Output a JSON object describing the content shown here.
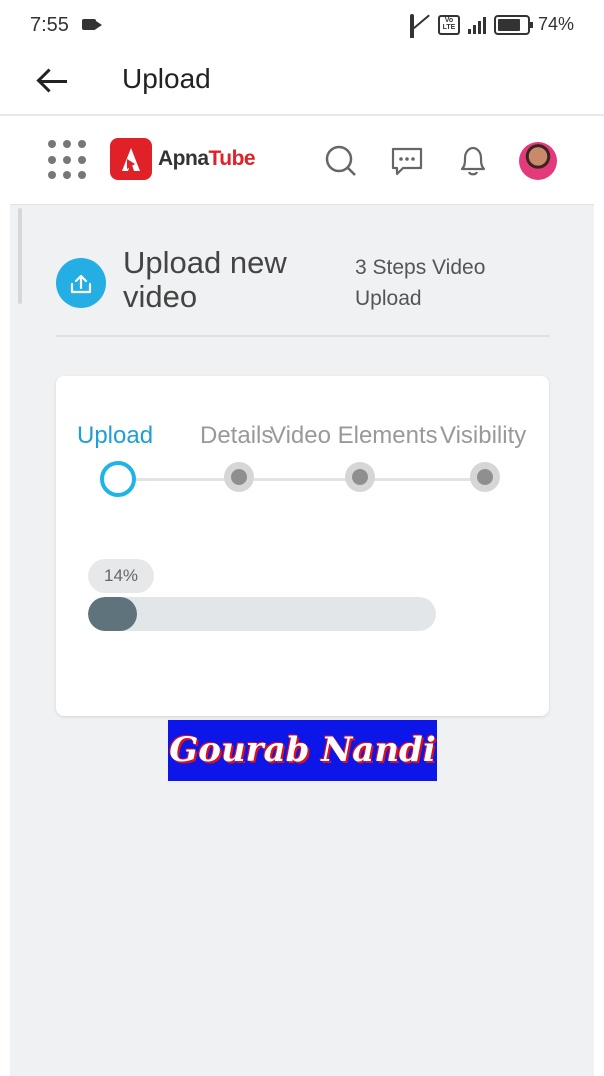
{
  "status_bar": {
    "time": "7:55",
    "battery": "74%",
    "icons": [
      "video-camera-icon",
      "bell-off-icon",
      "volte-icon",
      "signal-4g-icon",
      "battery-icon"
    ]
  },
  "app_bar": {
    "title": "Upload",
    "back_icon": "arrow-left-icon"
  },
  "header": {
    "brand_first": "Apna",
    "brand_second": "Tube",
    "brand_color": "#e02127",
    "icons": [
      "apps-grid-icon",
      "search-icon",
      "message-icon",
      "notification-bell-icon",
      "avatar"
    ]
  },
  "upload_section": {
    "title": "Upload new video",
    "subtitle": "3 Steps Video Upload",
    "icon": "cloud-upload-icon",
    "accent_color": "#24aee4"
  },
  "stepper": {
    "steps": [
      {
        "label": "Upload",
        "state": "active"
      },
      {
        "label": "Details",
        "state": "pending"
      },
      {
        "label": "Video Elements",
        "state": "pending"
      },
      {
        "label": "Visibility",
        "state": "pending"
      }
    ],
    "active_color": "#1e9fd6"
  },
  "progress": {
    "label": "14%",
    "value": 0.14
  },
  "watermark": {
    "text": "Gourab Nandi"
  }
}
